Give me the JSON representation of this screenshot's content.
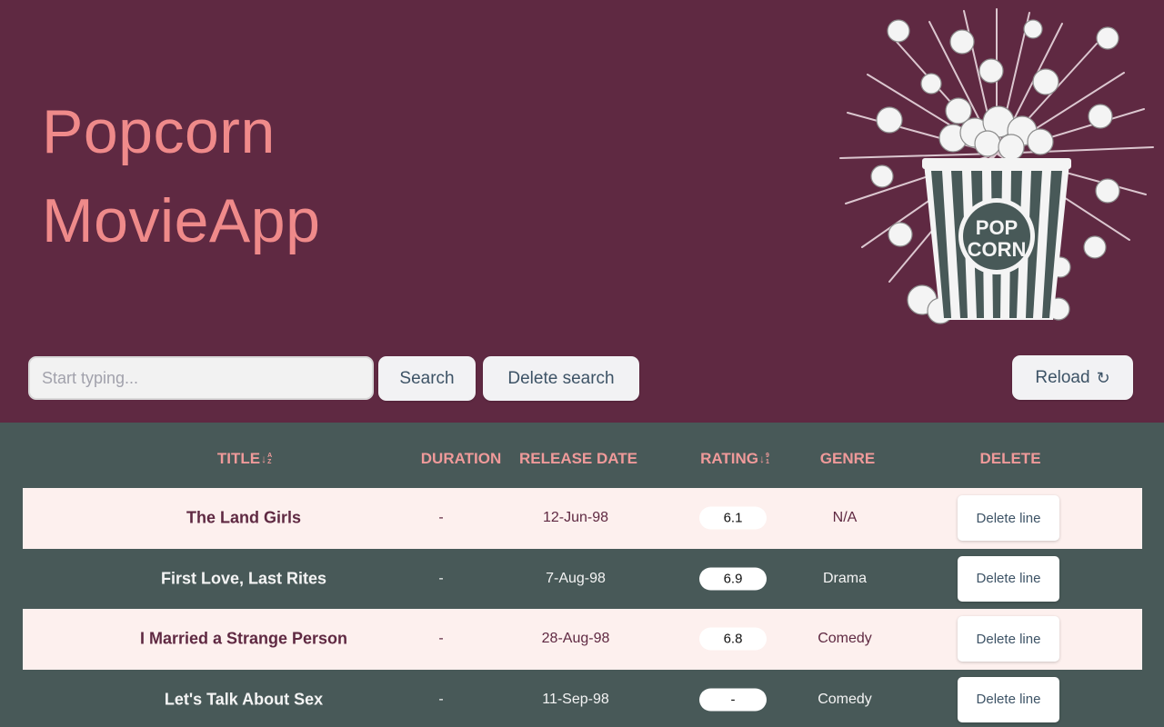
{
  "header": {
    "title_line1": "Popcorn",
    "title_line2": "MovieApp",
    "logo_line1": "POP",
    "logo_line2": "CORN"
  },
  "search": {
    "placeholder": "Start typing...",
    "value": "",
    "search_label": "Search",
    "delete_search_label": "Delete search",
    "reload_label": "Reload"
  },
  "table": {
    "columns": {
      "title": "TITLE",
      "duration": "DURATION",
      "release_date": "RELEASE DATE",
      "rating": "RATING",
      "genre": "GENRE",
      "delete": "DELETE"
    },
    "rows": [
      {
        "title": "The Land Girls",
        "duration": "-",
        "release_date": "12-Jun-98",
        "rating": "6.1",
        "genre": "N/A",
        "delete_label": "Delete line"
      },
      {
        "title": "First Love, Last Rites",
        "duration": "-",
        "release_date": "7-Aug-98",
        "rating": "6.9",
        "genre": "Drama",
        "delete_label": "Delete line"
      },
      {
        "title": "I Married a Strange Person",
        "duration": "-",
        "release_date": "28-Aug-98",
        "rating": "6.8",
        "genre": "Comedy",
        "delete_label": "Delete line"
      },
      {
        "title": "Let's Talk About Sex",
        "duration": "-",
        "release_date": "11-Sep-98",
        "rating": "-",
        "genre": "Comedy",
        "delete_label": "Delete line"
      }
    ]
  },
  "colors": {
    "header_bg": "#5f2942",
    "table_bg": "#485958",
    "row_light_bg": "#fdf0ee",
    "title_text": "#ef8a8a",
    "column_header_text": "#ef9a9a",
    "button_text": "#3d5366"
  },
  "icons": {
    "reload": "reload-icon",
    "sort_alpha": "sort-alpha-icon",
    "sort_numeric": "sort-numeric-icon",
    "popcorn": "popcorn-bucket-icon"
  }
}
